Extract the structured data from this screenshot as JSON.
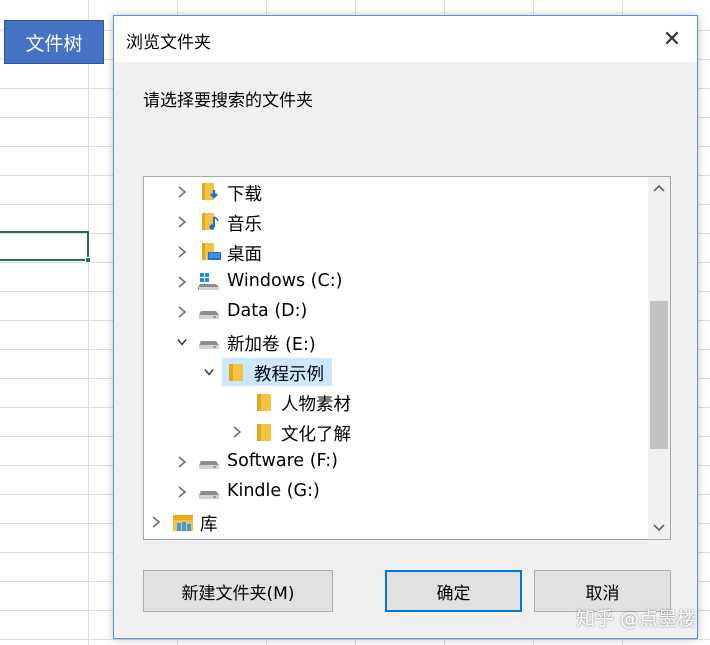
{
  "spreadsheet": {
    "shape_button_label": "文件树"
  },
  "dialog": {
    "title": "浏览文件夹",
    "close_glyph": "✕",
    "prompt": "请选择要搜索的文件夹",
    "tree": [
      {
        "label": "下载",
        "icon": "downloads-folder-icon",
        "expander": "collapsed"
      },
      {
        "label": "音乐",
        "icon": "music-folder-icon",
        "expander": "collapsed"
      },
      {
        "label": "桌面",
        "icon": "desktop-folder-icon",
        "expander": "collapsed"
      },
      {
        "label": "Windows (C:)",
        "icon": "windows-drive-icon",
        "expander": "collapsed"
      },
      {
        "label": "Data (D:)",
        "icon": "drive-icon",
        "expander": "collapsed"
      },
      {
        "label": "新加卷 (E:)",
        "icon": "drive-icon",
        "expander": "expanded"
      },
      {
        "label": "教程示例",
        "icon": "folder-icon",
        "expander": "expanded",
        "selected": true
      },
      {
        "label": "人物素材",
        "icon": "folder-icon",
        "expander": "none"
      },
      {
        "label": "文化了解",
        "icon": "folder-icon",
        "expander": "collapsed"
      },
      {
        "label": "Software (F:)",
        "icon": "drive-icon",
        "expander": "collapsed"
      },
      {
        "label": "Kindle (G:)",
        "icon": "drive-icon",
        "expander": "collapsed"
      },
      {
        "label": "库",
        "icon": "library-icon",
        "expander": "collapsed"
      }
    ],
    "buttons": {
      "new_folder": "新建文件夹(M)",
      "ok": "确定",
      "cancel": "取消"
    }
  },
  "watermark": "知乎 @点墨楼",
  "colors": {
    "accent": "#0078d7",
    "selection": "#cce8ff",
    "shape_fill": "#4472c4",
    "cell_border": "#217346"
  }
}
